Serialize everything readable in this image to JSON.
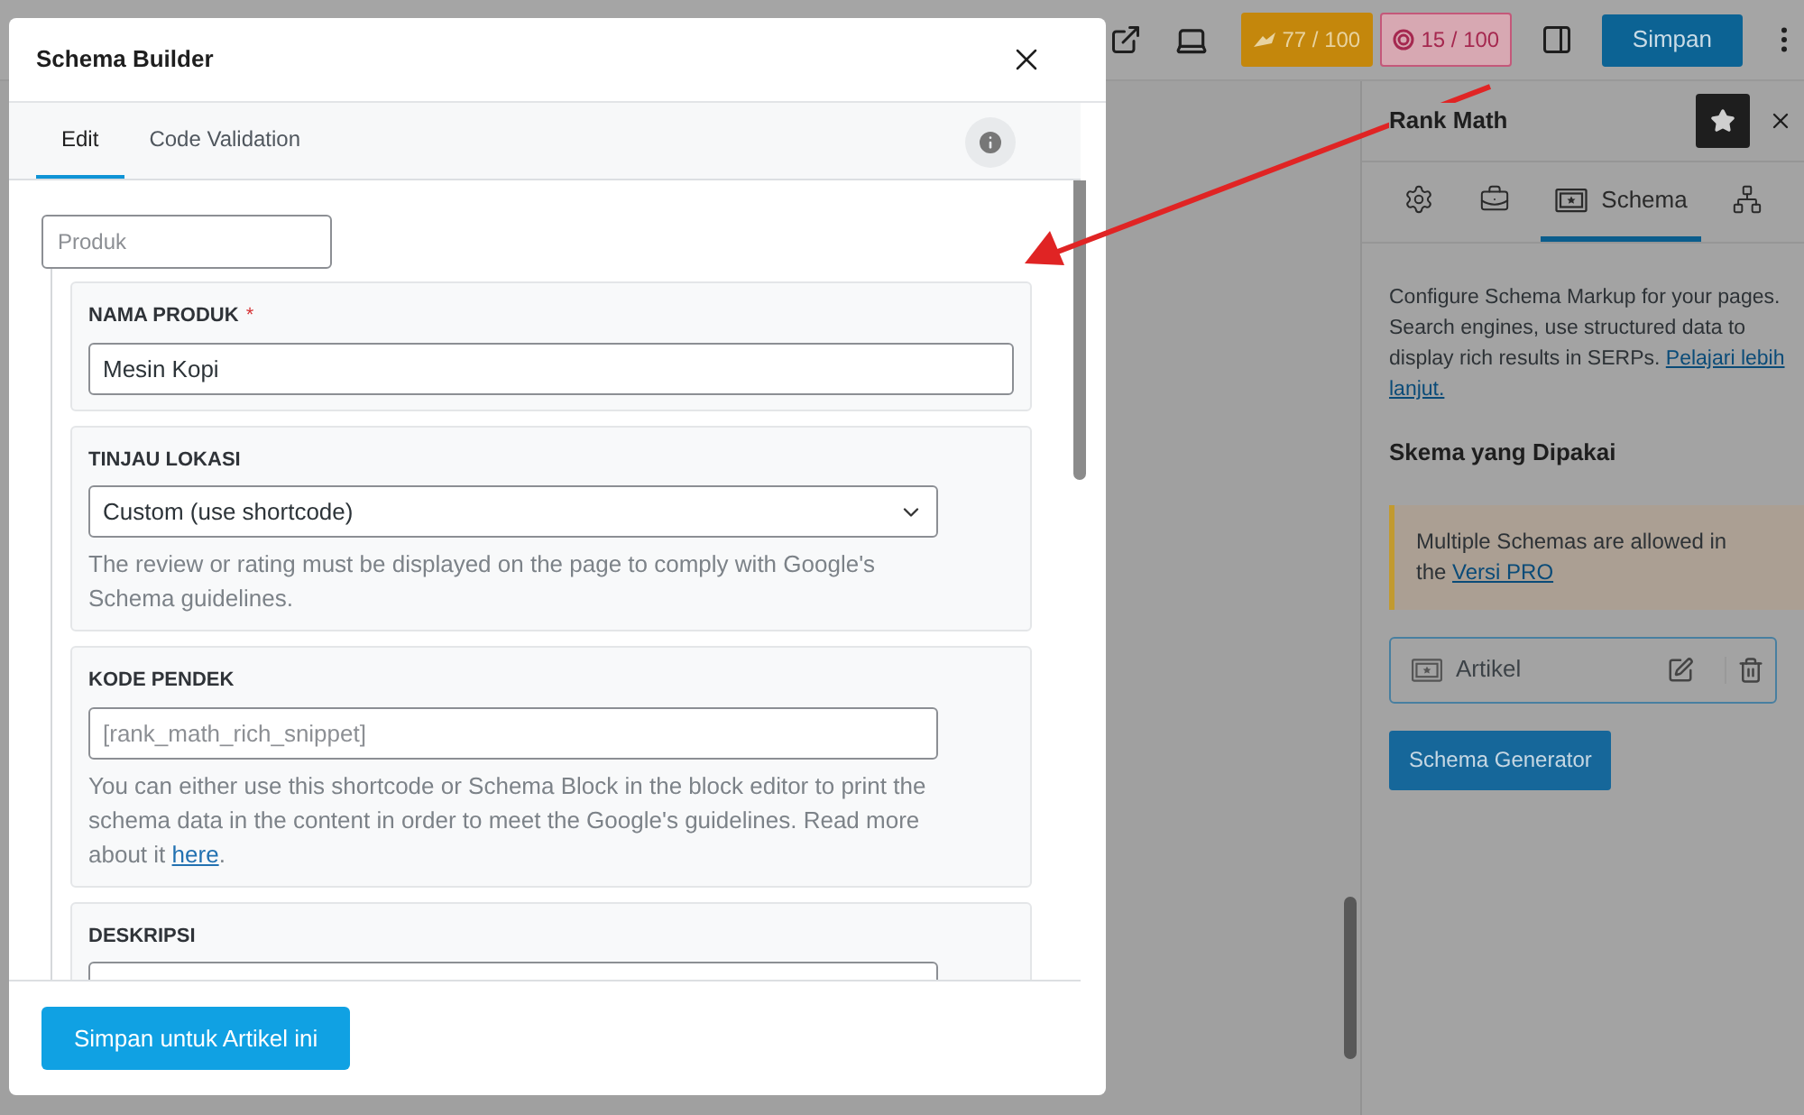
{
  "toolbar": {
    "seo_score": "77 / 100",
    "readability_score": "15 / 100",
    "save_button": "Simpan"
  },
  "sidebar": {
    "title": "Rank Math",
    "tabs": [
      {
        "kind": "settings",
        "selected": false
      },
      {
        "kind": "briefcase",
        "selected": false
      },
      {
        "kind": "schema",
        "label": "Schema",
        "selected": true
      },
      {
        "kind": "graph",
        "selected": false
      }
    ],
    "description": "Configure Schema Markup for your pages. Search engines, use structured data to display rich results in SERPs.",
    "learn_more_link_lines": [
      "Pelajari lebih",
      "lanjut."
    ],
    "section_title": "Skema yang Dipakai",
    "notice": {
      "text": "Multiple Schemas are allowed in the",
      "link": "Versi PRO"
    },
    "schemas": [
      {
        "name": "Artikel"
      }
    ],
    "generator_button": "Schema Generator"
  },
  "modal": {
    "title": "Schema Builder",
    "tabs": [
      {
        "label": "Edit",
        "selected": true
      },
      {
        "label": "Code Validation",
        "selected": false
      }
    ],
    "schema_type_field": {
      "placeholder": "Produk"
    },
    "fields": [
      {
        "kind": "text",
        "label": "NAMA PRODUK",
        "required_mark": "*",
        "value": "Mesin Kopi"
      },
      {
        "kind": "select",
        "label": "TINJAU LOKASI",
        "value": "Custom (use shortcode)",
        "help": "The review or rating must be displayed on the page to comply with Google's Schema guidelines."
      },
      {
        "kind": "short",
        "label": "KODE PENDEK",
        "placeholder": "[rank_math_rich_snippet]",
        "help": "You can either use this shortcode or Schema Block in the block editor to print the schema data in the content in order to meet the Google's guidelines. Read more about it",
        "help_link": "here",
        "help_end": "."
      },
      {
        "kind": "short",
        "label": "DESKRIPSI"
      }
    ],
    "save_button": "Simpan untuk Artikel ini"
  }
}
